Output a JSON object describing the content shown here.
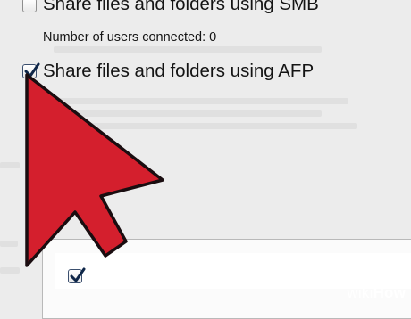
{
  "sharing": {
    "smb_label": "Share files and folders using SMB",
    "smb_checked": false,
    "users_connected": "Number of users connected: 0",
    "afp_label": "Share files and folders using AFP",
    "afp_checked": true
  },
  "list": {
    "row_checked": true
  },
  "overlay": {
    "pointer": "red-arrow-pointer",
    "arrow_color": "#d41f2d",
    "arrow_outline": "#1a0d10"
  },
  "watermark": {
    "wiki": "wiki",
    "how": "How"
  }
}
